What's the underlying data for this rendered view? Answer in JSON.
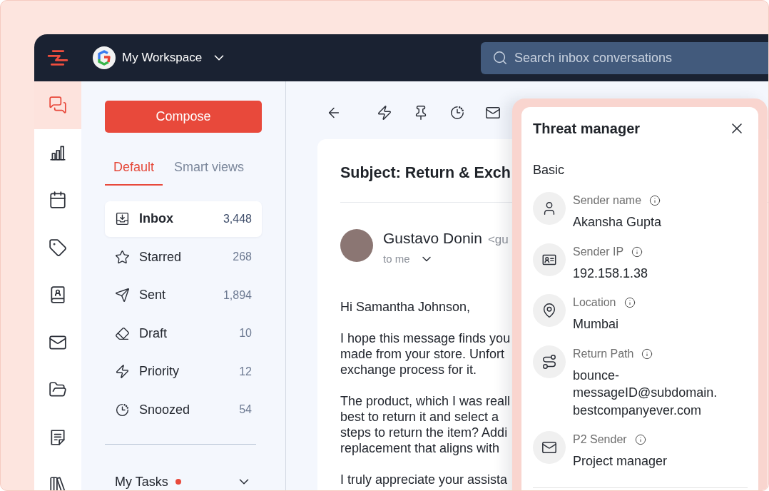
{
  "header": {
    "workspace": "My Workspace",
    "search_placeholder": "Search inbox conversations"
  },
  "rail": [
    {
      "selected": true
    },
    {
      "selected": false
    },
    {
      "selected": false
    },
    {
      "selected": false
    },
    {
      "selected": false
    },
    {
      "selected": false
    },
    {
      "selected": false
    },
    {
      "selected": false
    },
    {
      "selected": false
    }
  ],
  "sidebar": {
    "compose": "Compose",
    "tabs": [
      {
        "label": "Default",
        "selected": true
      },
      {
        "label": "Smart views",
        "selected": false
      }
    ],
    "folders": [
      {
        "label": "Inbox",
        "count": "3,448",
        "selected": true
      },
      {
        "label": "Starred",
        "count": "268",
        "selected": false
      },
      {
        "label": "Sent",
        "count": "1,894",
        "selected": false
      },
      {
        "label": "Draft",
        "count": "10",
        "selected": false
      },
      {
        "label": "Priority",
        "count": "12",
        "selected": false
      },
      {
        "label": "Snoozed",
        "count": "54",
        "selected": false
      }
    ],
    "my_tasks": {
      "label": "My Tasks",
      "has_new": true
    }
  },
  "email": {
    "subject": "Subject: Return & Exch",
    "sender": "Gustavo Donin",
    "address": "<gu",
    "recipient": "to me",
    "paragraphs": [
      [
        "Hi Samantha Johnson,"
      ],
      [
        "I hope this message finds you",
        "made from your store. Unfort",
        "exchange process for it."
      ],
      [
        "The product, which I was reall",
        "best to return it and select a",
        "steps to return the item? Addi",
        "replacement that aligns with"
      ],
      [
        "I truly appreciate your assista"
      ]
    ]
  },
  "threat_manager": {
    "title": "Threat manager",
    "section": "Basic",
    "fields": [
      {
        "label": "Sender name",
        "value_lines": [
          "Akansha Gupta"
        ]
      },
      {
        "label": "Sender IP",
        "value_lines": [
          "192.158.1.38"
        ]
      },
      {
        "label": "Location",
        "value_lines": [
          "Mumbai"
        ]
      },
      {
        "label": "Return Path",
        "value_lines": [
          "bounce-",
          "messageID@subdomain.",
          "bestcompanyever.com"
        ]
      },
      {
        "label": "P2 Sender",
        "value_lines": [
          "Project manager"
        ]
      }
    ]
  }
}
